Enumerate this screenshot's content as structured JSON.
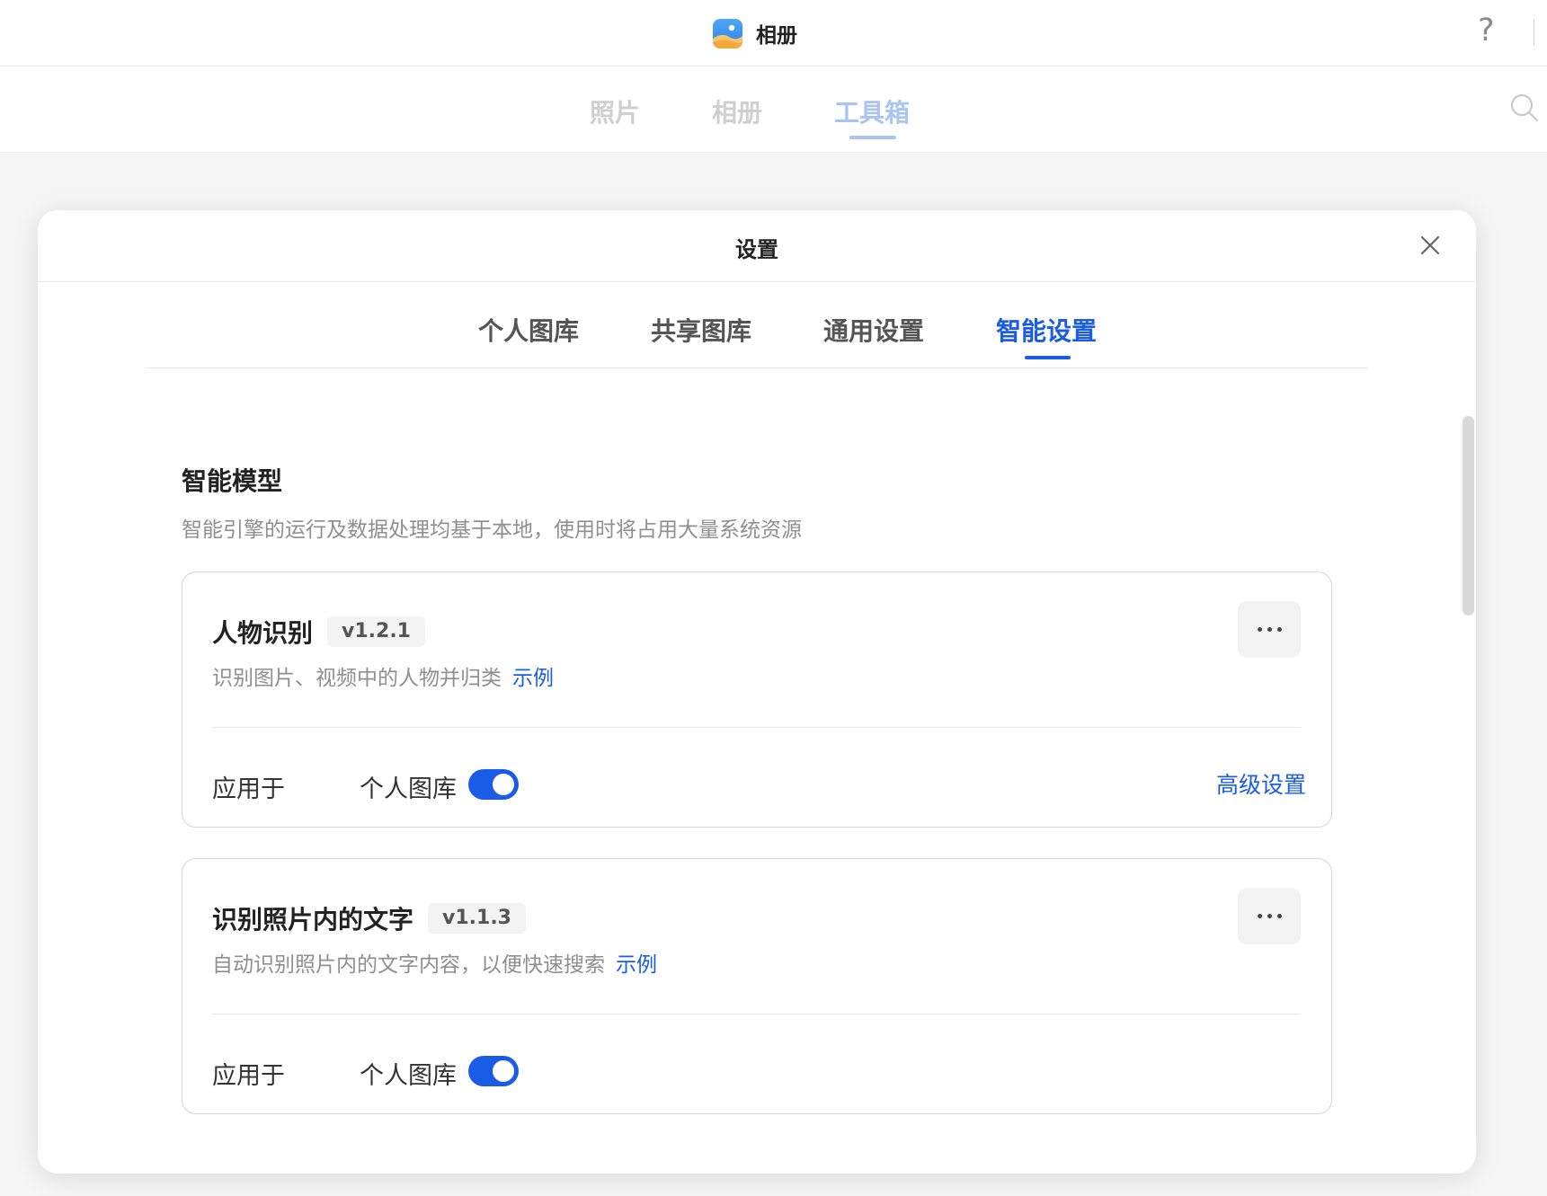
{
  "app": {
    "title": "相册",
    "help_label": "?"
  },
  "nav": {
    "tabs": [
      {
        "label": "照片"
      },
      {
        "label": "相册"
      },
      {
        "label": "工具箱",
        "active": true
      }
    ]
  },
  "dialog": {
    "title": "设置",
    "tabs": [
      {
        "label": "个人图库"
      },
      {
        "label": "共享图库"
      },
      {
        "label": "通用设置"
      },
      {
        "label": "智能设置",
        "active": true
      }
    ]
  },
  "section": {
    "title": "智能模型",
    "description": "智能引擎的运行及数据处理均基于本地，使用时将占用大量系统资源"
  },
  "cards": [
    {
      "title": "人物识别",
      "version": "v1.2.1",
      "description": "识别图片、视频中的人物并归类",
      "example_link": "示例",
      "apply_label": "应用于",
      "library_label": "个人图库",
      "toggle_on": true,
      "advanced_link": "高级设置"
    },
    {
      "title": "识别照片内的文字",
      "version": "v1.1.3",
      "description": "自动识别照片内的文字内容，以便快速搜索",
      "example_link": "示例",
      "apply_label": "应用于",
      "library_label": "个人图库",
      "toggle_on": true
    }
  ],
  "colors": {
    "accent": "#1a5ce6",
    "muted_accent": "#a9c4f2",
    "text": "#222222",
    "secondary_text": "#8f8f8f"
  }
}
